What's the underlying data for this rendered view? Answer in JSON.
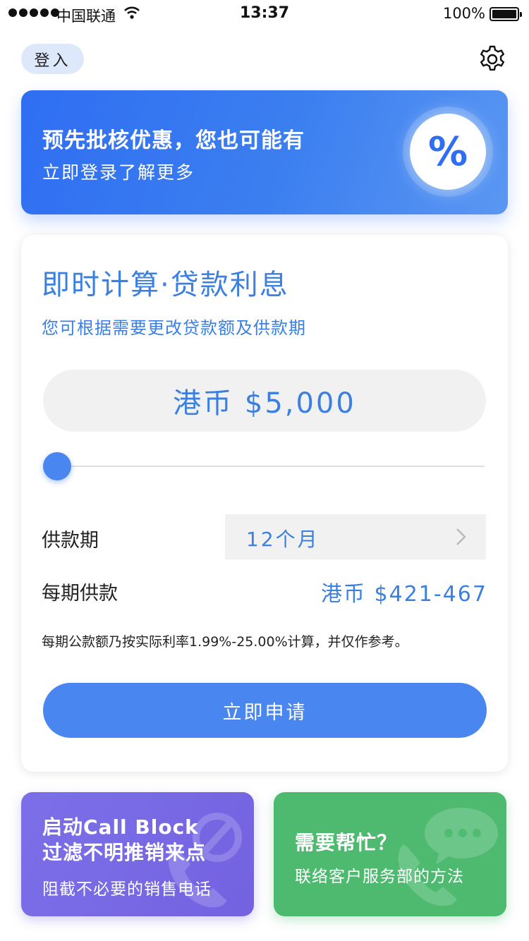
{
  "status_bar": {
    "carrier": "中国联通",
    "time": "13:37",
    "battery": "100%"
  },
  "header": {
    "login_label": "登入",
    "settings_icon": "gear-icon"
  },
  "promo": {
    "title": "预先批核优惠，您也可能有",
    "subtitle": "立即登录了解更多",
    "badge": "%"
  },
  "calculator": {
    "title": "即时计算·贷款利息",
    "subtitle": "您可根据需要更改贷款额及供款期",
    "amount": "港币 $5,000",
    "slider_level": 0,
    "term_label": "供款期",
    "term_value": "12个月",
    "payment_label": "每期供款",
    "payment_value": "港币 $421-467",
    "disclaimer": "每期公款额乃按实际利率1.99%-25.00%计算，并仅作参考。",
    "apply_label": "立即申请"
  },
  "callblock": {
    "title_line1": "启动Call Block",
    "title_line2": "过滤不明推销来点",
    "subtitle": "阻截不必要的销售电话"
  },
  "help": {
    "title": "需要帮忙？",
    "subtitle": "联络客户服务部的方法"
  },
  "colors": {
    "accent": "#3b7fe0",
    "button": "#4a86f0",
    "banner": "#2f6ef2",
    "callblock": "#7462e0",
    "help": "#4dba6f"
  }
}
